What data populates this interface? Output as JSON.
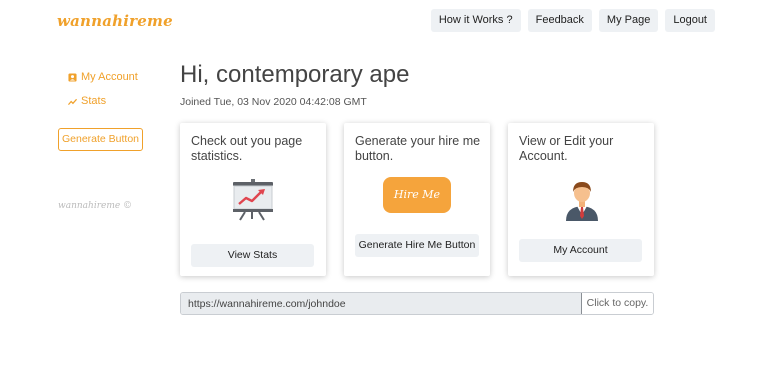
{
  "header": {
    "brand": "wannahireme",
    "nav": [
      {
        "label": "How it Works ?"
      },
      {
        "label": "Feedback"
      },
      {
        "label": "My Page"
      },
      {
        "label": "Logout"
      }
    ]
  },
  "sidebar": {
    "items": [
      {
        "label": "My Account",
        "icon": "account-icon"
      },
      {
        "label": "Stats",
        "icon": "stats-icon"
      }
    ],
    "generate_label": "Generate Button",
    "footer": "wannahireme ©"
  },
  "main": {
    "greeting": "Hi, contemporary ape",
    "joined": "Joined Tue, 03 Nov 2020 04:42:08 GMT",
    "cards": [
      {
        "text": "Check out you page statistics.",
        "button": "View Stats",
        "icon": "presentation-chart-icon"
      },
      {
        "text": "Generate your hire me button.",
        "badge": "Hire Me",
        "button": "Generate Hire Me Button"
      },
      {
        "text": "View or Edit your Account.",
        "button": "My Account",
        "icon": "businessman-avatar-icon"
      }
    ],
    "url": {
      "value": "https://wannahireme.com/johndoe",
      "copy_label": "Click to copy."
    }
  },
  "colors": {
    "accent": "#f0a12b",
    "button_bg": "#eef1f4",
    "hire_badge": "#f5a43c"
  }
}
